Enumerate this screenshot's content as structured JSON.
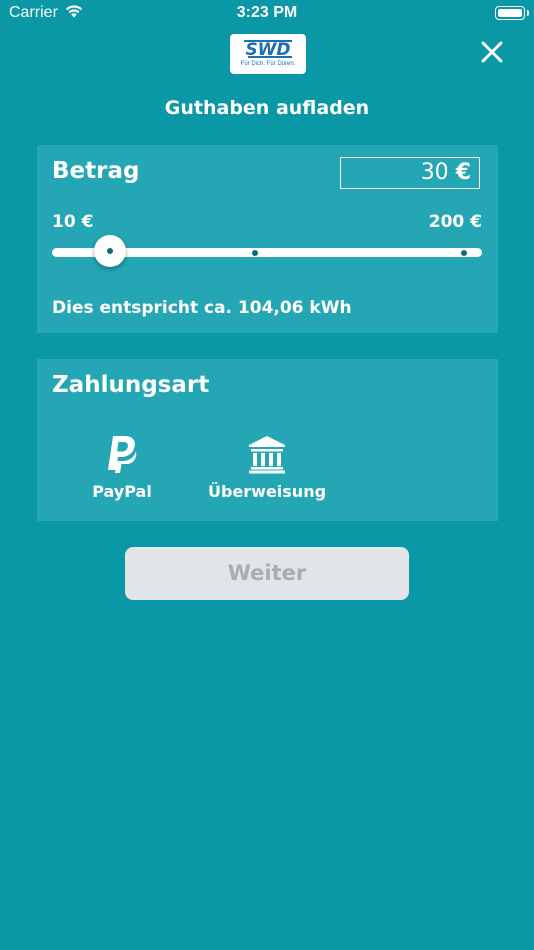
{
  "status_bar": {
    "carrier": "Carrier",
    "time": "3:23 PM"
  },
  "logo": {
    "brand": "SWD",
    "tagline": "Für Dich. Für Düren."
  },
  "header": {
    "title": "Guthaben aufladen"
  },
  "amount_card": {
    "heading": "Betrag",
    "amount_value": "30",
    "currency": "€",
    "range_min": "10 €",
    "range_max": "200 €",
    "slider_fraction": 0.1053,
    "energy_text": "Dies entspricht ca. 104,06 kWh"
  },
  "payment_card": {
    "heading": "Zahlungsart",
    "options": [
      {
        "label": "PayPal",
        "icon": "paypal-icon"
      },
      {
        "label": "Überweisung",
        "icon": "bank-icon"
      }
    ]
  },
  "next_button": {
    "label": "Weiter"
  },
  "colors": {
    "background": "#0a97a6",
    "card": "#25a6b5",
    "button_disabled_bg": "#e1e4e8",
    "button_disabled_text": "#a7adb3",
    "logo_blue": "#1a6fb5"
  }
}
